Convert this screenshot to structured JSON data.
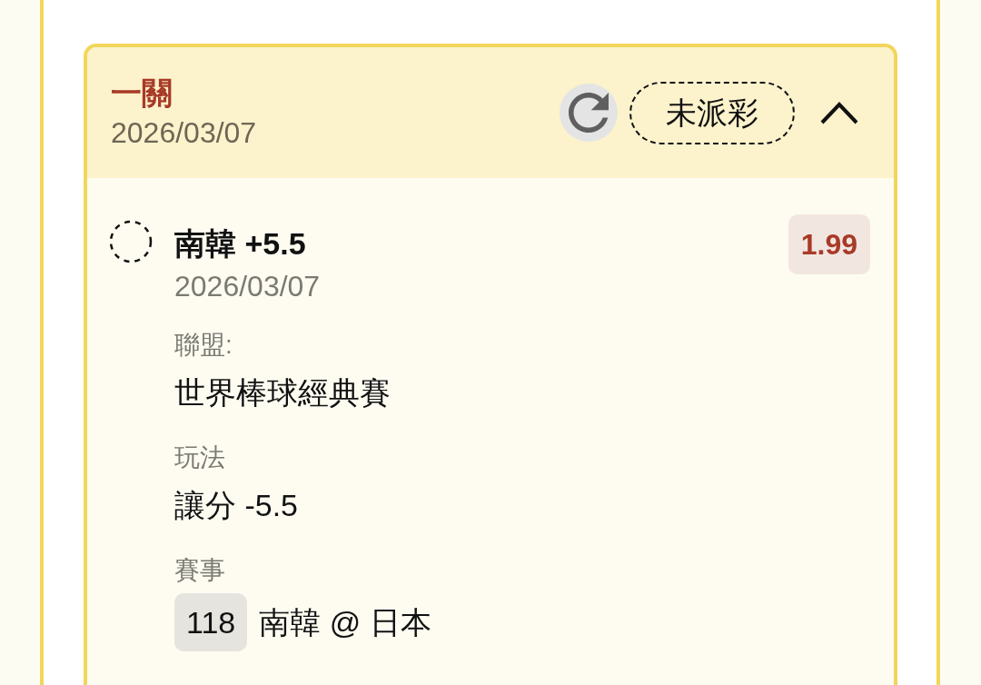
{
  "bet_card": {
    "title": "一關",
    "date": "2026/03/07",
    "status": {
      "label": "未派彩"
    },
    "expanded": true,
    "selections": [
      {
        "settled": false,
        "name": "南韓 +5.5",
        "date": "2026/03/07",
        "odds": "1.99",
        "details": [
          {
            "kind": "text",
            "label": "聯盟:",
            "value": "世界棒球經典賽"
          },
          {
            "kind": "text",
            "label": "玩法",
            "value": "讓分 -5.5"
          },
          {
            "kind": "match",
            "label": "賽事",
            "match_number": "118",
            "value": "南韓 @ 日本"
          }
        ]
      }
    ]
  }
}
